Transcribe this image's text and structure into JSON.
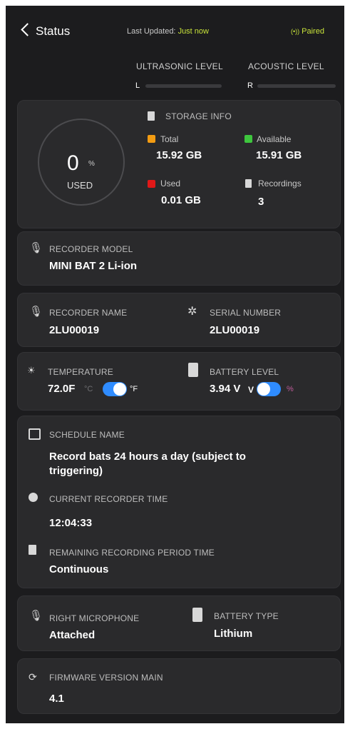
{
  "header": {
    "back_label": "Status",
    "last_updated_label": "Last Updated:",
    "last_updated_value": "Just now",
    "paired_label": "Paired"
  },
  "levels": {
    "ultrasonic_label": "ULTRASONIC LEVEL",
    "ultrasonic_channel": "L",
    "acoustic_label": "ACOUSTIC LEVEL",
    "acoustic_channel": "R"
  },
  "storage": {
    "title": "STORAGE INFO",
    "used_percent": "0",
    "percent_symbol": "%",
    "used_caption": "USED",
    "total_label": "Total",
    "total_value": "15.92 GB",
    "available_label": "Available",
    "available_value": "15.91 GB",
    "used_label": "Used",
    "used_value": "0.01 GB",
    "recordings_label": "Recordings",
    "recordings_value": "3",
    "colors": {
      "total": "#f39c12",
      "available": "#3ec63e",
      "used": "#e01818"
    }
  },
  "recorder_model": {
    "label": "RECORDER MODEL",
    "value": "MINI BAT 2 Li-ion"
  },
  "recorder_name": {
    "label": "RECORDER NAME",
    "value": "2LU00019"
  },
  "serial_number": {
    "label": "SERIAL NUMBER",
    "value": "2LU00019"
  },
  "temperature": {
    "label": "TEMPERATURE",
    "value": "72.0F",
    "unit_c": "°C",
    "unit_f": "°F",
    "toggle_on": true
  },
  "battery_level": {
    "label": "BATTERY LEVEL",
    "value": "3.94 V",
    "unit_v": "V",
    "unit_pct": "%",
    "toggle_on": false
  },
  "schedule": {
    "name_label": "SCHEDULE NAME",
    "name_value": "Record bats 24 hours a day (subject to triggering)",
    "time_label": "CURRENT RECORDER TIME",
    "time_value": "12:04:33",
    "remaining_label": "REMAINING RECORDING PERIOD TIME",
    "remaining_value": "Continuous"
  },
  "right_microphone": {
    "label": "RIGHT MICROPHONE",
    "value": "Attached"
  },
  "battery_type": {
    "label": "BATTERY TYPE",
    "value": "Lithium"
  },
  "firmware": {
    "label": "FIRMWARE VERSION MAIN",
    "value": "4.1"
  },
  "accent_color": "#c7e23a",
  "toggle_color": "#2f8cff",
  "icons": [
    "chevron-left-icon",
    "signal-icon",
    "sd-card-icon",
    "microphone-icon",
    "gear-icon",
    "sun-icon",
    "battery-icon",
    "calendar-icon",
    "clock-icon",
    "timer-icon",
    "sync-icon"
  ]
}
